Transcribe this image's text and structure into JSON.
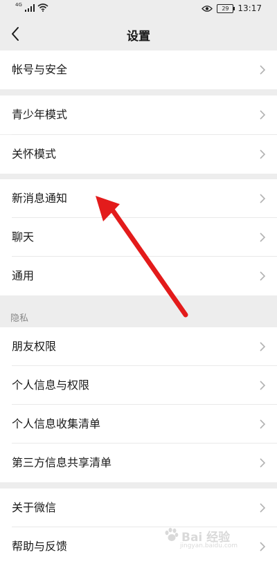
{
  "status_bar": {
    "network": "4G",
    "battery": "29",
    "time": "13:17"
  },
  "header": {
    "title": "设置"
  },
  "groups": [
    {
      "items": [
        "帐号与安全"
      ]
    },
    {
      "items": [
        "青少年模式",
        "关怀模式"
      ]
    },
    {
      "items": [
        "新消息通知",
        "聊天",
        "通用"
      ]
    },
    {
      "section_label": "隐私",
      "items": [
        "朋友权限",
        "个人信息与权限",
        "个人信息收集清单",
        "第三方信息共享清单"
      ]
    },
    {
      "items": [
        "关于微信",
        "帮助与反馈"
      ]
    }
  ],
  "watermark": {
    "text": "Bai 经验",
    "url": "jingyan.baidu.com"
  },
  "colors": {
    "background": "#ededed",
    "row": "#ffffff",
    "annotation_arrow": "#e31b1b"
  }
}
